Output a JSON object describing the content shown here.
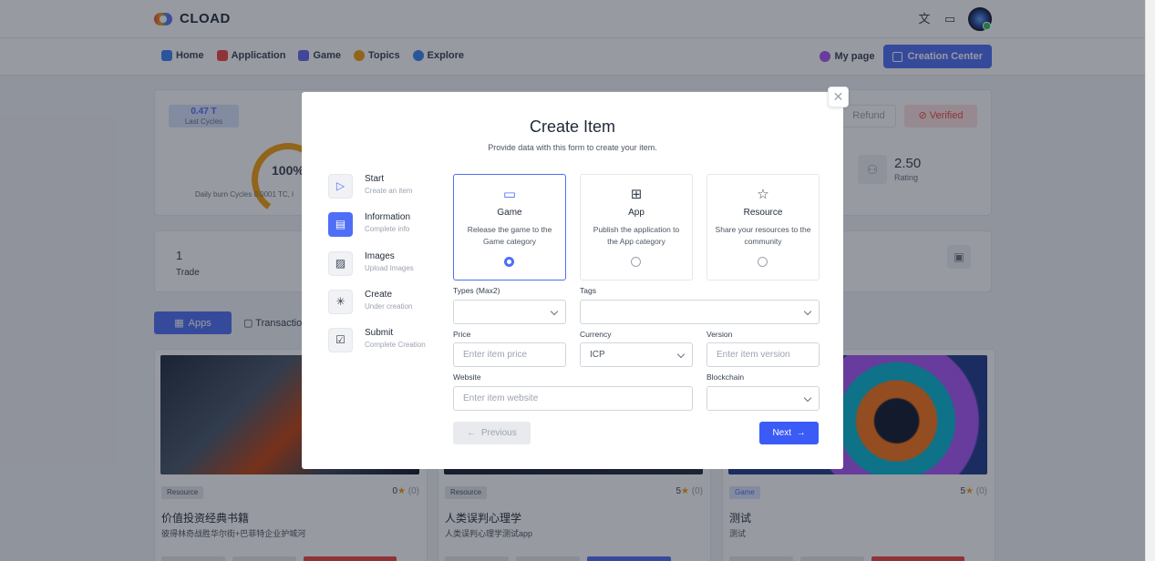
{
  "header": {
    "logo_text": "CLOAD",
    "translate_icon": "translate-icon",
    "laptop_icon": "laptop-icon"
  },
  "nav": {
    "items": [
      {
        "label": "Home",
        "icon": "home-icon",
        "color": "#3b82f6"
      },
      {
        "label": "Application",
        "icon": "apps-icon",
        "color": "#ef4444"
      },
      {
        "label": "Game",
        "icon": "gamepad-icon",
        "color": "#6366f1"
      },
      {
        "label": "Topics",
        "icon": "topics-icon",
        "color": "#f59e0b"
      },
      {
        "label": "Explore",
        "icon": "compass-icon",
        "color": "#3b82f6"
      }
    ],
    "my_page": "My page",
    "creation_center": "Creation Center"
  },
  "stats": {
    "cycles_value": "0.47 T",
    "cycles_label": "Last Cycles",
    "gauge_value": "100%",
    "burn_text": "Daily burn Cycles 0.0001 TC, l",
    "refund": "Refund",
    "verified": "Verified",
    "rating_value": "2.50",
    "rating_label": "Rating",
    "trade_value": "1",
    "trade_label": "Trade"
  },
  "tabs": {
    "apps": "Apps",
    "transactions": "Transaction"
  },
  "cards": [
    {
      "badge": "Resource",
      "score": "0",
      "count": "(0)",
      "title": "价值投资经典书籍",
      "subtitle": "彼得林奇战胜华尔街+巴菲特企业护城河"
    },
    {
      "badge": "Resource",
      "score": "5",
      "count": "(0)",
      "title": "人类误判心理学",
      "subtitle": "人类误判心理学测试app"
    },
    {
      "badge": "Game",
      "score": "5",
      "count": "(0)",
      "title": "测试",
      "subtitle": "测试"
    }
  ],
  "modal": {
    "title": "Create Item",
    "subtitle": "Provide data with this form to create your item.",
    "steps": [
      {
        "title": "Start",
        "sub": "Create an item",
        "icon": "play-icon"
      },
      {
        "title": "Information",
        "sub": "Complete info",
        "icon": "document-icon"
      },
      {
        "title": "Images",
        "sub": "Upload Images",
        "icon": "image-icon"
      },
      {
        "title": "Create",
        "sub": "Under creation",
        "icon": "loader-icon"
      },
      {
        "title": "Submit",
        "sub": "Complete Creation",
        "icon": "checkbox-icon"
      }
    ],
    "types": [
      {
        "title": "Game",
        "desc": "Release the game to the Game category",
        "icon": "gamepad-icon",
        "selected": true
      },
      {
        "title": "App",
        "desc": "Publish the application to the App category",
        "icon": "apps-grid-icon",
        "selected": false
      },
      {
        "title": "Resource",
        "desc": "Share your resources to the community",
        "icon": "star-icon",
        "selected": false
      }
    ],
    "form": {
      "types_label": "Types (Max2)",
      "tags_label": "Tags",
      "price_label": "Price",
      "price_placeholder": "Enter item price",
      "currency_label": "Currency",
      "currency_value": "ICP",
      "version_label": "Version",
      "version_placeholder": "Enter item version",
      "website_label": "Website",
      "website_placeholder": "Enter item website",
      "blockchain_label": "Blockchain"
    },
    "previous": "Previous",
    "next": "Next"
  }
}
